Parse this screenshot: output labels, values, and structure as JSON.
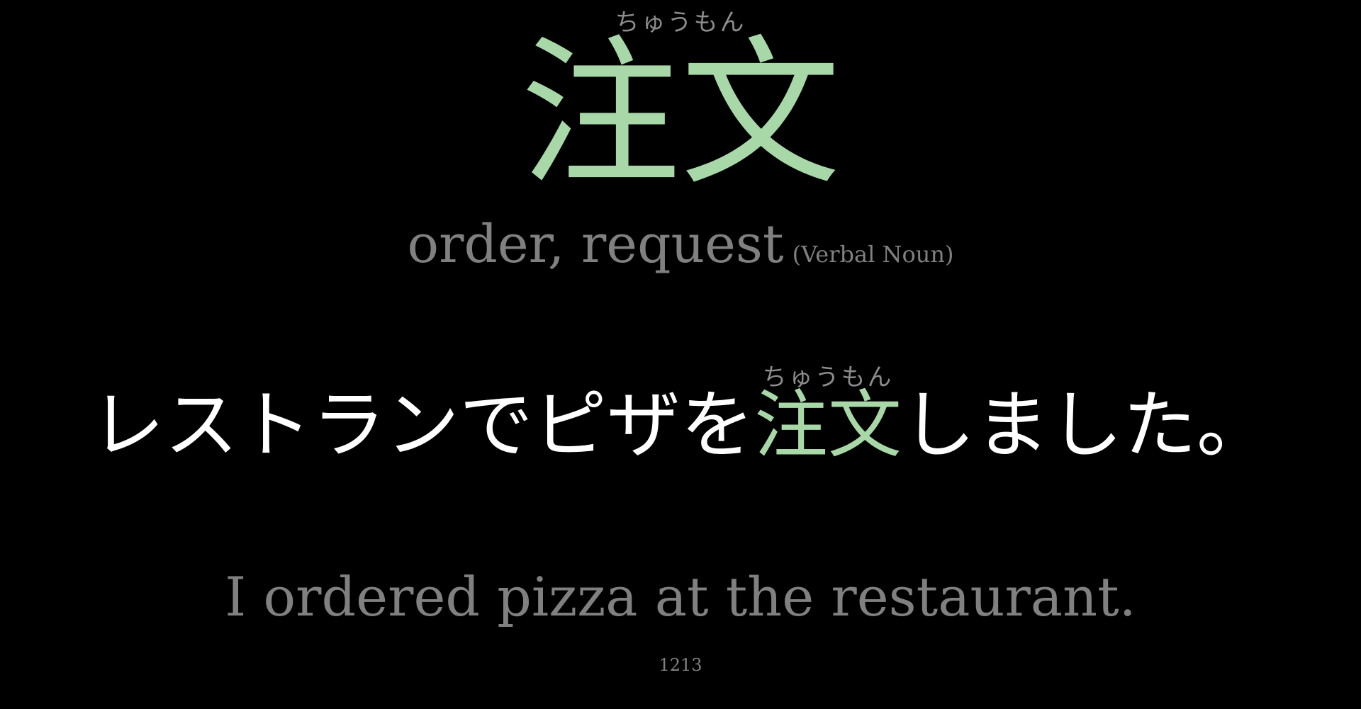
{
  "word": {
    "furigana": "ちゅうもん",
    "kanji": "注文",
    "meaning": "order, request",
    "part_of_speech": "(Verbal Noun)"
  },
  "example": {
    "before": "レストランでピザを",
    "target": "注文",
    "target_furigana": "ちゅうもん",
    "after": "しました。",
    "translation": "I ordered pizza at the restaurant."
  },
  "card_number": "1213",
  "colors": {
    "background": "#000000",
    "accent": "#a8d8a8",
    "muted": "#808080",
    "text": "#ffffff"
  }
}
